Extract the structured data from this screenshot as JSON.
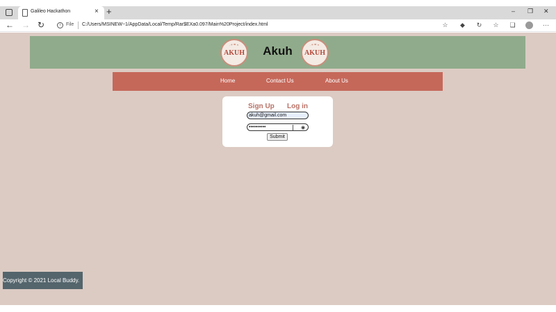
{
  "browser": {
    "tab_title": "Galileo Hackathon",
    "tab_close": "×",
    "new_tab": "+",
    "minimize": "–",
    "restore": "❐",
    "close": "✕",
    "back": "←",
    "forward": "→",
    "reload": "↻",
    "info_symbol": "i",
    "file_label": "File",
    "url": "C:/Users/MSINEW~1/AppData/Local/Temp/Rar$EXa0.097/Main%20Project/index.html",
    "more": "···"
  },
  "header": {
    "title": "Akuh",
    "logo_text": "AKUH"
  },
  "nav": {
    "items": [
      {
        "label": "Home"
      },
      {
        "label": "Contact Us"
      },
      {
        "label": "About Us"
      }
    ]
  },
  "auth": {
    "signup_label": "Sign Up",
    "login_label": "Log in",
    "email_value": "akuh@gmail.com",
    "password_value": "••••••••••",
    "submit_label": "Submit"
  },
  "footer": {
    "text": "Copyright © 2021 Local Buddy."
  },
  "colors": {
    "page_bg": "#dccbc3",
    "header_bg": "#90ab8b",
    "nav_bg": "#c5685a",
    "footer_bg": "#54656c",
    "accent_text": "#b97166"
  }
}
